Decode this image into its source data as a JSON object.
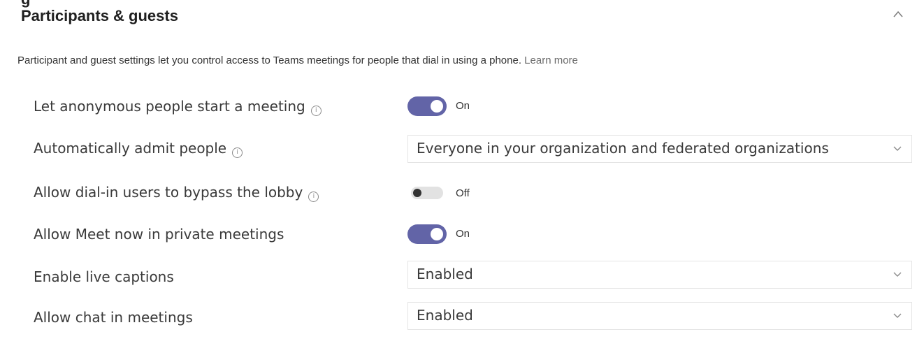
{
  "section": {
    "cut_letter": "g",
    "title": "Participants & guests",
    "description": "Participant and guest settings let you control access to Teams meetings for people that dial in using a phone.",
    "learn_more": "Learn more"
  },
  "settings": [
    {
      "label": "Let anonymous people start a meeting",
      "control": "toggle",
      "state": "On"
    },
    {
      "label": "Automatically admit people",
      "control": "dropdown",
      "value": "Everyone in your organization and federated organizations"
    },
    {
      "label": "Allow dial-in users to bypass the lobby",
      "control": "toggle",
      "state": "Off"
    },
    {
      "label": "Allow Meet now in private meetings",
      "control": "toggle",
      "state": "On"
    },
    {
      "label": "Enable live captions",
      "control": "dropdown",
      "value": "Enabled"
    },
    {
      "label": "Allow chat in meetings",
      "control": "dropdown",
      "value": "Enabled"
    }
  ],
  "colors": {
    "toggle_on": "#6264a7",
    "toggle_off_track": "#e2e2e2",
    "text": "#3a3a3a"
  },
  "icons": {
    "collapse": "chevron-up-icon",
    "info": "info-icon",
    "dropdown": "chevron-down-icon"
  }
}
